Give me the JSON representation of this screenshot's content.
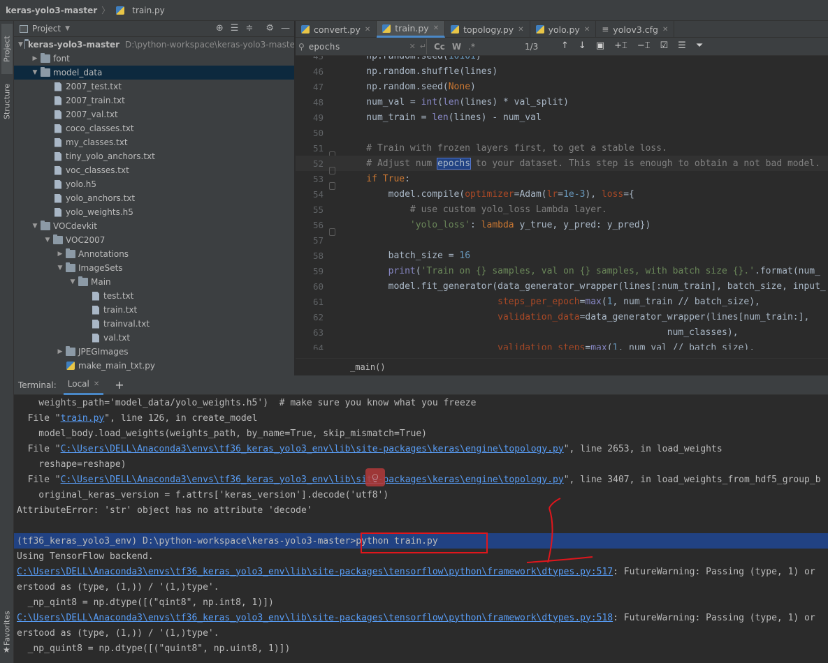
{
  "titlebar": {
    "project": "keras-yolo3-master",
    "file": "train.py"
  },
  "sidebar_tabs": {
    "project": "Project",
    "structure": "Structure",
    "favorites": "Favorites"
  },
  "project_panel": {
    "title": "Project",
    "tree": [
      {
        "indent": 0,
        "arrow": "▼",
        "kind": "folder",
        "label": "keras-yolo3-master",
        "path": "D:\\python-workspace\\keras-yolo3-maste",
        "bold": true
      },
      {
        "indent": 1,
        "arrow": "▶",
        "kind": "folder",
        "label": "font"
      },
      {
        "indent": 1,
        "arrow": "▼",
        "kind": "folder",
        "label": "model_data",
        "selected": true
      },
      {
        "indent": 2,
        "arrow": "",
        "kind": "file",
        "label": "2007_test.txt"
      },
      {
        "indent": 2,
        "arrow": "",
        "kind": "file",
        "label": "2007_train.txt"
      },
      {
        "indent": 2,
        "arrow": "",
        "kind": "file",
        "label": "2007_val.txt"
      },
      {
        "indent": 2,
        "arrow": "",
        "kind": "file",
        "label": "coco_classes.txt"
      },
      {
        "indent": 2,
        "arrow": "",
        "kind": "file",
        "label": "my_classes.txt"
      },
      {
        "indent": 2,
        "arrow": "",
        "kind": "file",
        "label": "tiny_yolo_anchors.txt"
      },
      {
        "indent": 2,
        "arrow": "",
        "kind": "file",
        "label": "voc_classes.txt"
      },
      {
        "indent": 2,
        "arrow": "",
        "kind": "file",
        "label": "yolo.h5"
      },
      {
        "indent": 2,
        "arrow": "",
        "kind": "file",
        "label": "yolo_anchors.txt"
      },
      {
        "indent": 2,
        "arrow": "",
        "kind": "file",
        "label": "yolo_weights.h5"
      },
      {
        "indent": 1,
        "arrow": "▼",
        "kind": "folder",
        "label": "VOCdevkit"
      },
      {
        "indent": 2,
        "arrow": "▼",
        "kind": "folder",
        "label": "VOC2007"
      },
      {
        "indent": 3,
        "arrow": "▶",
        "kind": "folder",
        "label": "Annotations"
      },
      {
        "indent": 3,
        "arrow": "▼",
        "kind": "folder",
        "label": "ImageSets"
      },
      {
        "indent": 4,
        "arrow": "▼",
        "kind": "folder",
        "label": "Main"
      },
      {
        "indent": 5,
        "arrow": "",
        "kind": "file",
        "label": "test.txt"
      },
      {
        "indent": 5,
        "arrow": "",
        "kind": "file",
        "label": "train.txt"
      },
      {
        "indent": 5,
        "arrow": "",
        "kind": "file",
        "label": "trainval.txt"
      },
      {
        "indent": 5,
        "arrow": "",
        "kind": "file",
        "label": "val.txt"
      },
      {
        "indent": 3,
        "arrow": "▶",
        "kind": "folder",
        "label": "JPEGImages"
      },
      {
        "indent": 3,
        "arrow": "",
        "kind": "py",
        "label": "make_main_txt.py"
      }
    ]
  },
  "editor_tabs": [
    {
      "label": "convert.py",
      "active": false
    },
    {
      "label": "train.py",
      "active": true
    },
    {
      "label": "topology.py",
      "active": false
    },
    {
      "label": "yolo.py",
      "active": false
    },
    {
      "label": "yolov3.cfg",
      "active": false
    }
  ],
  "find": {
    "query": "epochs",
    "count": "1/3",
    "case_btn": "Cc",
    "word_btn": "W",
    "regex_btn": ".*"
  },
  "code": [
    {
      "n": "45",
      "parts": [
        [
          "",
          "    np.random.seed("
        ],
        [
          "num",
          "10101"
        ],
        [
          "",
          ")"
        ]
      ]
    },
    {
      "n": "46",
      "parts": [
        [
          "",
          "    np.random.shuffle(lines)"
        ]
      ]
    },
    {
      "n": "47",
      "parts": [
        [
          "",
          "    np.random.seed("
        ],
        [
          "kw",
          "None"
        ],
        [
          "",
          ")"
        ]
      ]
    },
    {
      "n": "48",
      "parts": [
        [
          "",
          "    num_val = "
        ],
        [
          "fn",
          "int"
        ],
        [
          "",
          "("
        ],
        [
          "fn",
          "len"
        ],
        [
          "",
          "(lines) * val_split)"
        ]
      ]
    },
    {
      "n": "49",
      "parts": [
        [
          "",
          "    num_train = "
        ],
        [
          "fn",
          "len"
        ],
        [
          "",
          "(lines) - num_val"
        ]
      ]
    },
    {
      "n": "50",
      "parts": [
        [
          "",
          ""
        ]
      ]
    },
    {
      "n": "51",
      "fold": true,
      "parts": [
        [
          "cm",
          "    # Train with frozen layers first, to get a stable loss."
        ]
      ]
    },
    {
      "n": "52",
      "fold": true,
      "cur": true,
      "parts": [
        [
          "cm",
          "    # Adjust num "
        ],
        [
          "hl",
          "epochs"
        ],
        [
          "cm",
          " to your dataset. This step is enough to obtain a not bad model."
        ]
      ]
    },
    {
      "n": "53",
      "fold": true,
      "parts": [
        [
          "kw",
          "    if "
        ],
        [
          "kw",
          "True"
        ],
        [
          "",
          ":"
        ]
      ]
    },
    {
      "n": "54",
      "parts": [
        [
          "",
          "        model.compile("
        ],
        [
          "pn",
          "optimizer"
        ],
        [
          "",
          "=Adam("
        ],
        [
          "pn",
          "lr"
        ],
        [
          "",
          "="
        ],
        [
          "num",
          "1e-3"
        ],
        [
          "",
          "), "
        ],
        [
          "pn",
          "loss"
        ],
        [
          "",
          "={"
        ]
      ]
    },
    {
      "n": "55",
      "parts": [
        [
          "cm",
          "            # use custom yolo_loss Lambda layer."
        ]
      ]
    },
    {
      "n": "56",
      "fold": true,
      "parts": [
        [
          "str",
          "            'yolo_loss'"
        ],
        [
          "",
          ": "
        ],
        [
          "kw",
          "lambda "
        ],
        [
          "",
          "y_true, y_pred: y_pred})"
        ]
      ]
    },
    {
      "n": "57",
      "parts": [
        [
          "",
          ""
        ]
      ]
    },
    {
      "n": "58",
      "parts": [
        [
          "",
          "        batch_size = "
        ],
        [
          "num",
          "16"
        ]
      ]
    },
    {
      "n": "59",
      "parts": [
        [
          "",
          "        "
        ],
        [
          "fn",
          "print"
        ],
        [
          "",
          "("
        ],
        [
          "str",
          "'Train on {} samples, val on {} samples, with batch size {}.'"
        ],
        [
          "",
          ".format(num_"
        ]
      ]
    },
    {
      "n": "60",
      "parts": [
        [
          "",
          "        model.fit_generator(data_generator_wrapper(lines[:num_train], batch_size, input_"
        ]
      ]
    },
    {
      "n": "61",
      "parts": [
        [
          "",
          "                            "
        ],
        [
          "pn",
          "steps_per_epoch"
        ],
        [
          "",
          "="
        ],
        [
          "fn",
          "max"
        ],
        [
          "",
          "("
        ],
        [
          "num",
          "1"
        ],
        [
          "",
          ", num_train // batch_size),"
        ]
      ]
    },
    {
      "n": "62",
      "parts": [
        [
          "",
          "                            "
        ],
        [
          "pn",
          "validation_data"
        ],
        [
          "",
          "=data_generator_wrapper(lines[num_train:], "
        ]
      ]
    },
    {
      "n": "63",
      "parts": [
        [
          "",
          "                                                           num_classes),"
        ]
      ]
    },
    {
      "n": "64",
      "parts": [
        [
          "",
          "                            "
        ],
        [
          "pn",
          "validation_steps"
        ],
        [
          "",
          "="
        ],
        [
          "fn",
          "max"
        ],
        [
          "",
          "("
        ],
        [
          "num",
          "1"
        ],
        [
          "",
          ", num_val // batch_size),"
        ]
      ]
    }
  ],
  "breadcrumb": "_main()",
  "terminal": {
    "label": "Terminal:",
    "tab": "Local",
    "lines": [
      {
        "parts": [
          [
            "",
            "    weights_path='model_data/yolo_weights.h5')  # make sure you know what you freeze"
          ]
        ]
      },
      {
        "parts": [
          [
            "",
            "  File \""
          ],
          [
            "lnk",
            "train.py"
          ],
          [
            "",
            "\", line 126, in create_model"
          ]
        ]
      },
      {
        "parts": [
          [
            "",
            "    model_body.load_weights(weights_path, by_name=True, skip_mismatch=True)"
          ]
        ]
      },
      {
        "parts": [
          [
            "",
            "  File \""
          ],
          [
            "lnk",
            "C:\\Users\\DELL\\Anaconda3\\envs\\tf36_keras_yolo3_env\\lib\\site-packages\\keras\\engine\\topology.py"
          ],
          [
            "",
            "\", line 2653, in load_weights"
          ]
        ]
      },
      {
        "parts": [
          [
            "",
            "    reshape=reshape)"
          ]
        ]
      },
      {
        "parts": [
          [
            "",
            "  File \""
          ],
          [
            "lnk",
            "C:\\Users\\DELL\\Anaconda3\\envs\\tf36_keras_yolo3_env\\lib\\site-packages\\keras\\engine\\topology.py"
          ],
          [
            "",
            "\", line 3407, in load_weights_from_hdf5_group_b"
          ]
        ]
      },
      {
        "parts": [
          [
            "",
            "    original_keras_version = f.attrs['keras_version'].decode('utf8')"
          ]
        ]
      },
      {
        "parts": [
          [
            "",
            "AttributeError: 'str' object has no attribute 'decode'"
          ]
        ]
      },
      {
        "parts": [
          [
            "",
            ""
          ]
        ]
      },
      {
        "hl": true,
        "parts": [
          [
            "",
            "(tf36_keras_yolo3_env) D:\\python-workspace\\keras-yolo3-master>python train.py"
          ]
        ]
      },
      {
        "parts": [
          [
            "",
            "Using TensorFlow backend."
          ]
        ]
      },
      {
        "parts": [
          [
            "lnk",
            "C:\\Users\\DELL\\Anaconda3\\envs\\tf36_keras_yolo3_env\\lib\\site-packages\\tensorflow\\python\\framework\\dtypes.py:517"
          ],
          [
            "",
            ": FutureWarning: Passing (type, 1) or"
          ]
        ]
      },
      {
        "parts": [
          [
            "",
            "erstood as (type, (1,)) / '(1,)type'."
          ]
        ]
      },
      {
        "parts": [
          [
            "",
            "  _np_qint8 = np.dtype([(\"qint8\", np.int8, 1)])"
          ]
        ]
      },
      {
        "parts": [
          [
            "lnk",
            "C:\\Users\\DELL\\Anaconda3\\envs\\tf36_keras_yolo3_env\\lib\\site-packages\\tensorflow\\python\\framework\\dtypes.py:518"
          ],
          [
            "",
            ": FutureWarning: Passing (type, 1) or"
          ]
        ]
      },
      {
        "parts": [
          [
            "",
            "erstood as (type, (1,)) / '(1,)type'."
          ]
        ]
      },
      {
        "parts": [
          [
            "",
            "  _np_quint8 = np.dtype([(\"quint8\", np.uint8, 1)])"
          ]
        ]
      }
    ]
  },
  "annotation_color": "#e0161c"
}
